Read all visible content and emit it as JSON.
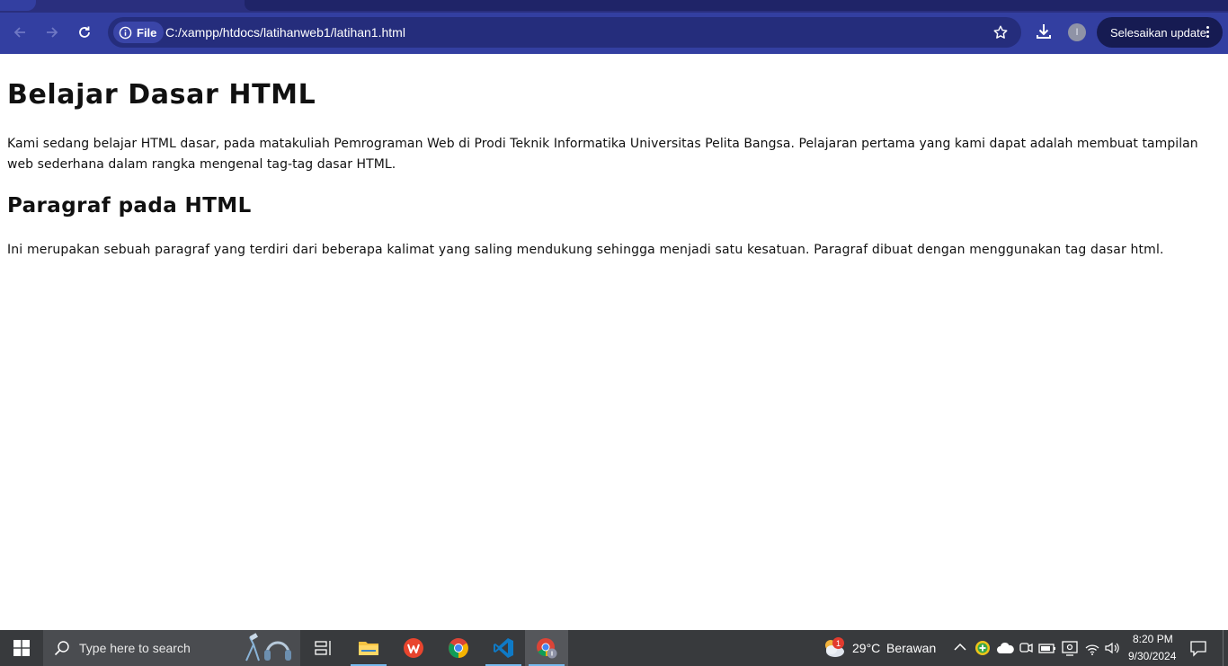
{
  "browser": {
    "site_chip_label": "File",
    "url": "C:/xampp/htdocs/latihanweb1/latihan1.html",
    "profile_initial": "I",
    "update_button_label": "Selesaikan update",
    "colors": {
      "toolbar": "#333fa1",
      "omnibox": "#252d7c",
      "update_pill": "#161b52"
    }
  },
  "page": {
    "heading1": "Belajar Dasar HTML",
    "paragraph1": "Kami sedang belajar HTML dasar, pada matakuliah Pemrograman Web di Prodi Teknik Informatika Universitas Pelita Bangsa. Pelajaran pertama yang kami dapat adalah membuat tampilan web sederhana dalam rangka mengenal tag-tag dasar HTML.",
    "heading2": "Paragraf pada HTML",
    "paragraph2": "Ini merupakan sebuah paragraf yang terdiri dari beberapa kalimat yang saling mendukung sehingga menjadi satu kesatuan. Paragraf dibuat dengan menggunakan tag dasar html."
  },
  "taskbar": {
    "search_placeholder": "Type here to search",
    "weather_badge": "1",
    "temperature": "29°C",
    "weather_condition": "Berawan",
    "time": "8:20 PM",
    "date": "9/30/2024",
    "apps": [
      "task-view",
      "file-explorer",
      "wps-office",
      "google-chrome",
      "vs-code",
      "google-chrome-profile"
    ]
  }
}
